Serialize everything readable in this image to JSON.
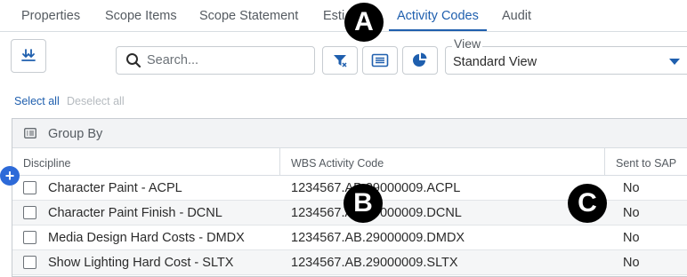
{
  "tabs": [
    {
      "label": "Properties",
      "active": false
    },
    {
      "label": "Scope Items",
      "active": false
    },
    {
      "label": "Scope Statement",
      "active": false
    },
    {
      "label": "Esti",
      "active": false
    },
    {
      "label": "Activity Codes",
      "active": true
    },
    {
      "label": "Audit",
      "active": false
    }
  ],
  "toolbar": {
    "search_placeholder": "Search...",
    "view_label": "View",
    "view_value": "Standard View"
  },
  "selection": {
    "select_all": "Select all",
    "deselect_all": "Deselect all"
  },
  "grid": {
    "group_by_label": "Group By",
    "columns": [
      "Discipline",
      "WBS Activity Code",
      "Sent to SAP"
    ],
    "rows": [
      {
        "discipline": "Character Paint - ACPL",
        "wbs": "1234567.AB.29000009.ACPL",
        "sent": "No"
      },
      {
        "discipline": "Character Paint Finish - DCNL",
        "wbs": "1234567.AB.29000009.DCNL",
        "sent": "No"
      },
      {
        "discipline": "Media Design Hard Costs - DMDX",
        "wbs": "1234567.AB.29000009.DMDX",
        "sent": "No"
      },
      {
        "discipline": "Show Lighting Hard Cost - SLTX",
        "wbs": "1234567.AB.29000009.SLTX",
        "sent": "No"
      }
    ]
  },
  "markers": {
    "a": "A",
    "b": "B",
    "c": "C"
  },
  "colors": {
    "accent": "#1f5fae",
    "add_button": "#2d6ad8"
  }
}
